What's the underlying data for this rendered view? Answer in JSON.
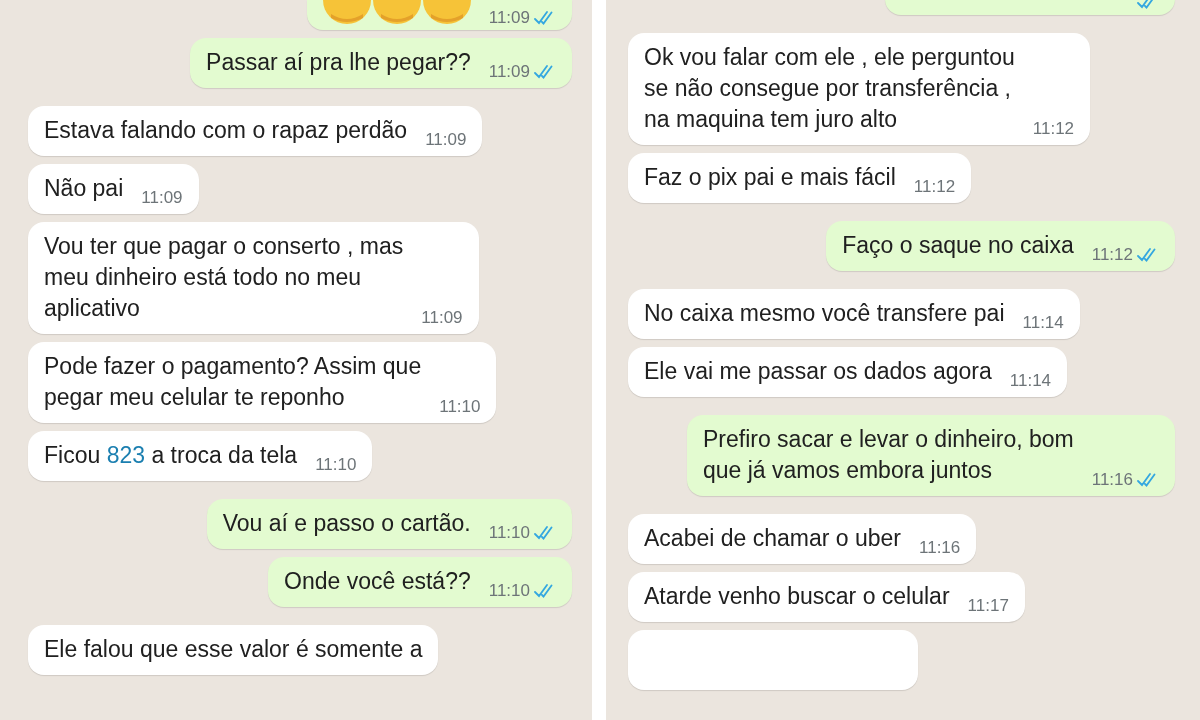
{
  "panels": [
    {
      "messages": [
        {
          "outgoing": true,
          "kind": "emoji",
          "time": "11:09",
          "read": true
        },
        {
          "outgoing": true,
          "text": "Passar aí pra lhe pegar??",
          "time": "11:09",
          "read": true
        },
        {
          "outgoing": false,
          "text": "Estava falando com o rapaz perdão",
          "time": "11:09"
        },
        {
          "outgoing": false,
          "text": "Não pai",
          "time": "11:09"
        },
        {
          "outgoing": false,
          "text": "Vou ter que pagar o conserto , mas\nmeu dinheiro está todo no meu\naplicativo",
          "time": "11:09"
        },
        {
          "outgoing": false,
          "text": "Pode fazer o pagamento? Assim que\npegar meu celular te reponho",
          "time": "11:10"
        },
        {
          "outgoing": false,
          "parts": [
            {
              "text": "Ficou "
            },
            {
              "text": "823",
              "kind": "link"
            },
            {
              "text": " a troca da tela"
            }
          ],
          "time": "11:10"
        },
        {
          "outgoing": true,
          "text": "Vou aí e passo o cartão.",
          "time": "11:10",
          "read": true
        },
        {
          "outgoing": true,
          "text": "Onde você está??",
          "time": "11:10",
          "read": true
        },
        {
          "outgoing": false,
          "text": "Ele falou  que esse valor é somente a"
        }
      ]
    },
    {
      "messages": [
        {
          "outgoing": true,
          "kind": "cut",
          "read": true
        },
        {
          "outgoing": false,
          "text": "Ok vou falar com ele , ele perguntou\nse não consegue por transferência ,\nna maquina tem juro alto",
          "time": "11:12"
        },
        {
          "outgoing": false,
          "text": "Faz o pix pai e mais fácil",
          "time": "11:12"
        },
        {
          "outgoing": true,
          "text": "Faço o saque no caixa",
          "time": "11:12",
          "read": true
        },
        {
          "outgoing": false,
          "text": "No caixa mesmo você transfere pai",
          "time": "11:14"
        },
        {
          "outgoing": false,
          "text": "Ele vai me passar os dados agora",
          "time": "11:14"
        },
        {
          "outgoing": true,
          "text": "Prefiro sacar e levar o dinheiro, bom\nque já vamos embora juntos",
          "time": "11:16",
          "read": true
        },
        {
          "outgoing": false,
          "text": "Acabei de chamar o uber",
          "time": "11:16"
        },
        {
          "outgoing": false,
          "text": "Atarde venho buscar o celular",
          "time": "11:17"
        },
        {
          "outgoing": false,
          "kind": "cut"
        }
      ]
    }
  ]
}
